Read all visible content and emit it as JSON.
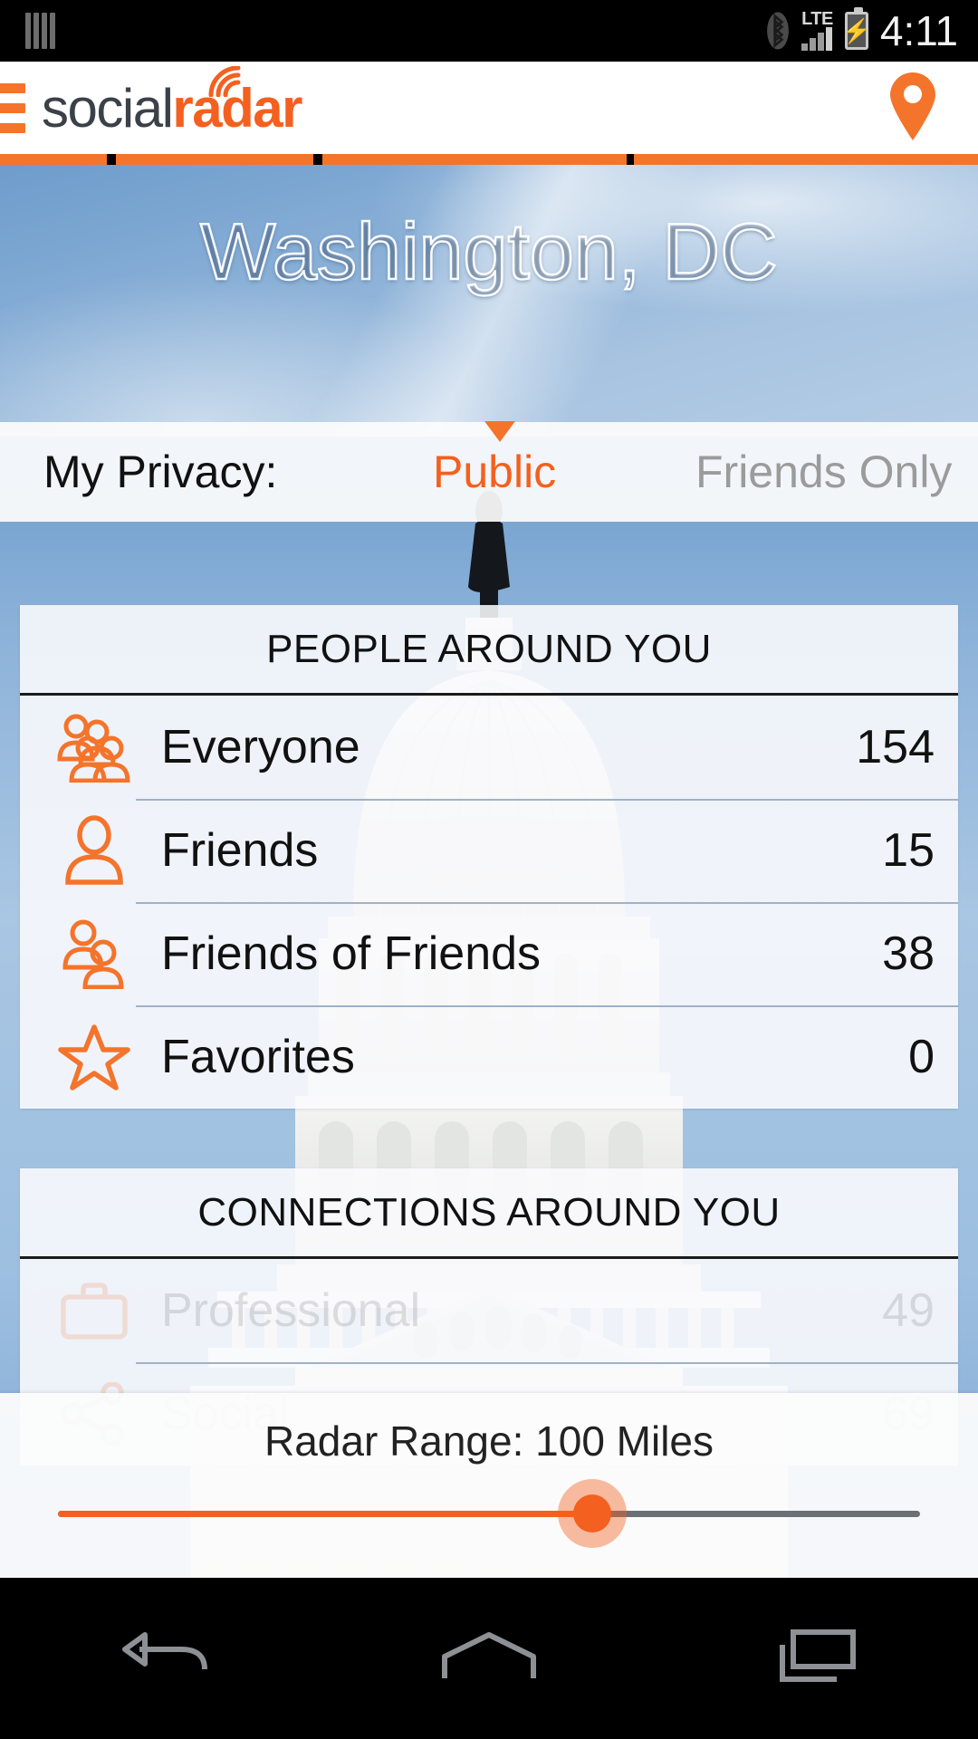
{
  "status_bar": {
    "left_icon": "sim-bars-icon",
    "bluetooth_icon": "bluetooth-icon",
    "network_type": "LTE",
    "signal_icon": "signal-bars-icon",
    "battery_icon": "battery-charging-icon",
    "time": "4:11"
  },
  "header": {
    "menu_icon": "hamburger-menu-icon",
    "logo_part1": "social",
    "logo_part2": "radar",
    "location_icon": "map-pin-icon"
  },
  "hero": {
    "title": "Washington, DC"
  },
  "privacy": {
    "label": "My Privacy:",
    "options": [
      {
        "label": "Public",
        "active": true
      },
      {
        "label": "Friends Only",
        "active": false
      }
    ]
  },
  "people_card": {
    "title": "PEOPLE AROUND YOU",
    "rows": [
      {
        "icon": "group-people-icon",
        "label": "Everyone",
        "count": "154"
      },
      {
        "icon": "person-icon",
        "label": "Friends",
        "count": "15"
      },
      {
        "icon": "two-people-icon",
        "label": "Friends of Friends",
        "count": "38"
      },
      {
        "icon": "star-icon",
        "label": "Favorites",
        "count": "0"
      }
    ]
  },
  "connections_card": {
    "title": "CONNECTIONS AROUND YOU",
    "rows": [
      {
        "icon": "briefcase-icon",
        "label": "Professional",
        "count": "49"
      },
      {
        "icon": "share-nodes-icon",
        "label": "Social",
        "count": "69"
      }
    ]
  },
  "radar_range": {
    "label": "Radar Range: 100 Miles",
    "value_percent": 62
  },
  "nav_bar": {
    "back_icon": "back-arrow-icon",
    "home_icon": "home-icon",
    "recents_icon": "recent-apps-icon"
  },
  "colors": {
    "accent_orange": "#f4601f",
    "accent_orange_light": "#f4742b",
    "muted_gray": "#9b9b9b",
    "text_dark": "#111111"
  }
}
